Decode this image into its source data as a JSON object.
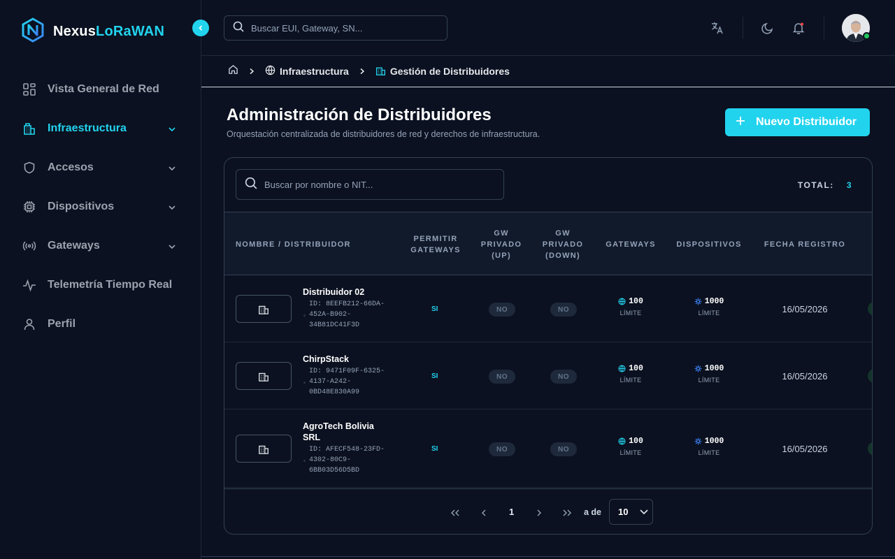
{
  "brand": {
    "part1": "Nexus",
    "part2": "LoRaWAN",
    "accent": "#22d3ee"
  },
  "sidebar": {
    "items": [
      {
        "label": "Vista General de Red",
        "icon": "grid-icon",
        "active": false,
        "expandable": false
      },
      {
        "label": "Infraestructura",
        "icon": "building-icon",
        "active": true,
        "expandable": true
      },
      {
        "label": "Accesos",
        "icon": "shield-icon",
        "active": false,
        "expandable": true
      },
      {
        "label": "Dispositivos",
        "icon": "chip-icon",
        "active": false,
        "expandable": true
      },
      {
        "label": "Gateways",
        "icon": "signal-icon",
        "active": false,
        "expandable": true
      },
      {
        "label": "Telemetría Tiempo Real",
        "icon": "activity-icon",
        "active": false,
        "expandable": false
      },
      {
        "label": "Perfil",
        "icon": "user-icon",
        "active": false,
        "expandable": false
      }
    ]
  },
  "topbar": {
    "search_placeholder": "Buscar EUI, Gateway, SN...",
    "icons": [
      "translate-icon",
      "moon-icon",
      "bell-icon",
      "avatar"
    ]
  },
  "breadcrumb": {
    "items": [
      {
        "label": "Infraestructura",
        "icon": "globe-icon"
      },
      {
        "label": "Gestión de Distribuidores",
        "icon": "building-icon"
      }
    ]
  },
  "page": {
    "title": "Administración de Distribuidores",
    "subtitle": "Orquestación centralizada de distribuidores de red y derechos de infraestructura.",
    "new_button": "Nuevo Distribuidor"
  },
  "table": {
    "search_placeholder": "Buscar por nombre o NIT...",
    "total_label": "TOTAL:",
    "total_value": "3",
    "columns": {
      "name": "NOMBRE / DISTRIBUIDOR",
      "allow": "PERMITIR GATEWAYS",
      "gw_up": "GW PRIVADO (UP)",
      "gw_down": "GW PRIVADO (DOWN)",
      "gateways": "GATEWAYS",
      "devices": "DISPOSITIVOS",
      "date": "FECHA REGISTRO"
    },
    "rows": [
      {
        "name": "Distribuidor 02",
        "id": "ID: 8EEFB212-66DA-452A-B902-34B81DC41F3D",
        "allow": "SI",
        "up": "NO",
        "down": "NO",
        "gateways": "100",
        "gateways_label": "LÍMITE",
        "devices": "1000",
        "devices_label": "LÍMITE",
        "date": "16/05/2026"
      },
      {
        "name": "ChirpStack",
        "id": "ID: 9471F09F-6325-4137-A242-0BD48E830A99",
        "allow": "SI",
        "up": "NO",
        "down": "NO",
        "gateways": "100",
        "gateways_label": "LÍMITE",
        "devices": "1000",
        "devices_label": "LÍMITE",
        "date": "16/05/2026"
      },
      {
        "name": "AgroTech Bolivia SRL",
        "id": "ID: AFECF548-23FD-4302-80C9-6BB03D56D5BD",
        "allow": "SI",
        "up": "NO",
        "down": "NO",
        "gateways": "100",
        "gateways_label": "LÍMITE",
        "devices": "1000",
        "devices_label": "LÍMITE",
        "date": "16/05/2026"
      }
    ]
  },
  "pager": {
    "current": "1",
    "of_label": "a de",
    "page_size": "10"
  }
}
